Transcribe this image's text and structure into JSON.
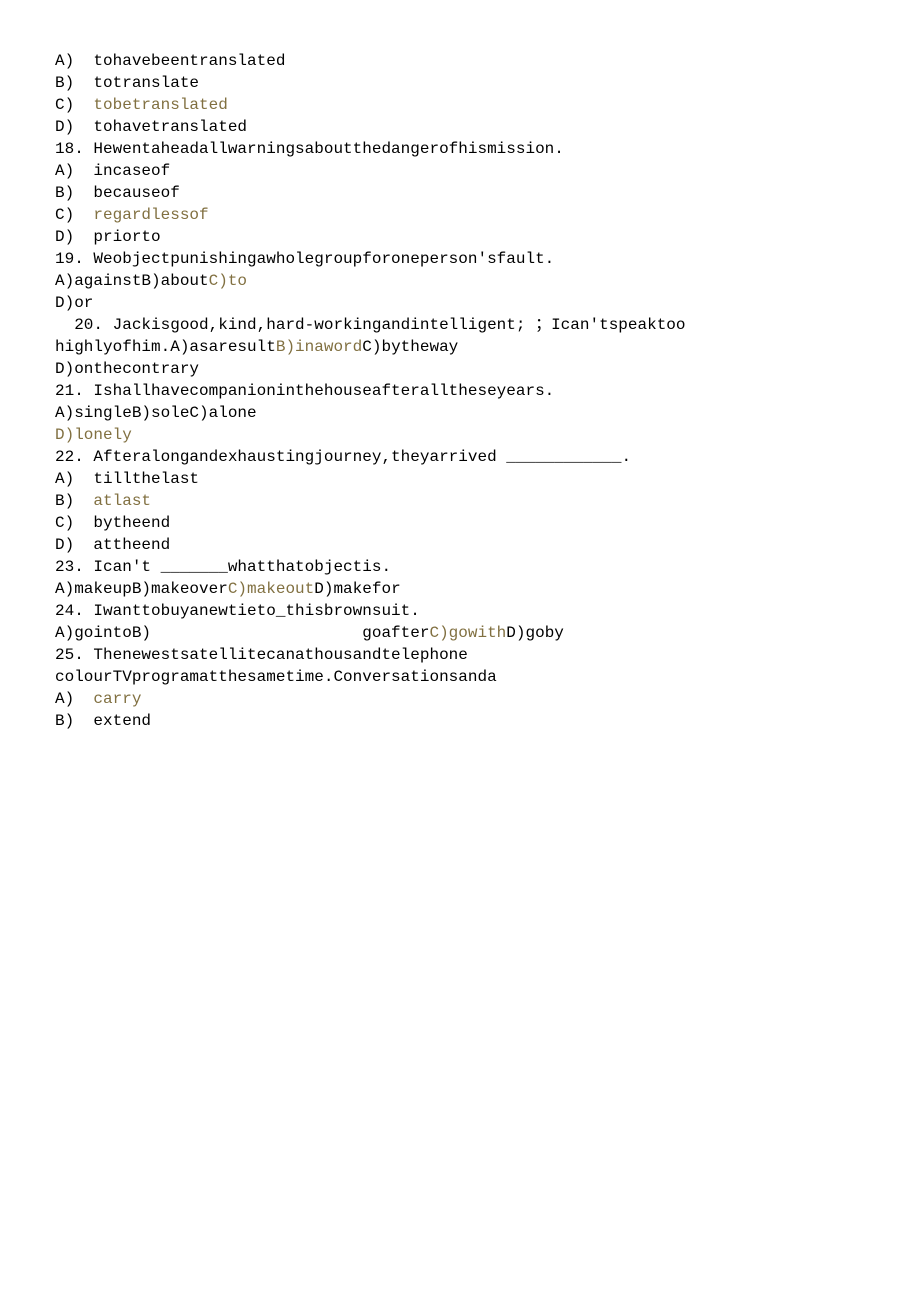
{
  "lines": [
    {
      "segs": [
        {
          "t": "A)  tohavebeentranslated"
        }
      ]
    },
    {
      "segs": [
        {
          "t": "B)  totranslate"
        }
      ]
    },
    {
      "segs": [
        {
          "t": "C)  "
        },
        {
          "t": "tobetranslated",
          "hl": true
        }
      ]
    },
    {
      "segs": [
        {
          "t": "D)  tohavetranslated"
        }
      ]
    },
    {
      "segs": [
        {
          "t": "18. Hewentaheadallwarningsaboutthedangerofhismission."
        }
      ]
    },
    {
      "segs": [
        {
          "t": "A)  incaseof"
        }
      ]
    },
    {
      "segs": [
        {
          "t": "B)  becauseof"
        }
      ]
    },
    {
      "segs": [
        {
          "t": "C)  "
        },
        {
          "t": "regardlessof",
          "hl": true
        }
      ]
    },
    {
      "segs": [
        {
          "t": "D)  priorto"
        }
      ]
    },
    {
      "segs": [
        {
          "t": "19. Weobjectpunishingawholegroupforoneperson'sfault."
        }
      ]
    },
    {
      "segs": [
        {
          "t": "A)againstB)about"
        },
        {
          "t": "C)to",
          "hl": true
        }
      ]
    },
    {
      "segs": [
        {
          "t": "D)or"
        }
      ]
    },
    {
      "segs": [
        {
          "t": "  20. Jackisgood,kind,hard-workingandintelligent; ；Ican'tspeaktoo"
        }
      ]
    },
    {
      "segs": [
        {
          "t": "highlyofhim.A)asaresult"
        },
        {
          "t": "B)inaword",
          "hl": true
        },
        {
          "t": "C)bytheway"
        }
      ]
    },
    {
      "segs": [
        {
          "t": "D)onthecontrary"
        }
      ]
    },
    {
      "segs": [
        {
          "t": "21. Ishallhavecompanioninthehouseafteralltheseyears."
        }
      ]
    },
    {
      "segs": [
        {
          "t": "A)singleB)soleC)alone"
        }
      ]
    },
    {
      "segs": [
        {
          "t": "D)lonely",
          "hl": true
        }
      ]
    },
    {
      "segs": [
        {
          "t": "22. Afteralongandexhaustingjourney,theyarrived ____________."
        }
      ]
    },
    {
      "segs": [
        {
          "t": "A)  tillthelast"
        }
      ]
    },
    {
      "segs": [
        {
          "t": "B)  "
        },
        {
          "t": "atlast",
          "hl": true
        }
      ]
    },
    {
      "segs": [
        {
          "t": "C)  bytheend"
        }
      ]
    },
    {
      "segs": [
        {
          "t": "D)  attheend"
        }
      ]
    },
    {
      "segs": [
        {
          "t": "23. Ican't _______whatthatobjectis."
        }
      ]
    },
    {
      "segs": [
        {
          "t": "A)makeupB)makeover"
        },
        {
          "t": "C)makeout",
          "hl": true
        },
        {
          "t": "D)makefor"
        }
      ]
    },
    {
      "segs": [
        {
          "t": "24. Iwanttobuyanewtieto_thisbrownsuit."
        }
      ]
    },
    {
      "segs": [
        {
          "t": "A)gointoB)                      goafter"
        },
        {
          "t": "C)gowith",
          "hl": true
        },
        {
          "t": "D)goby"
        }
      ]
    },
    {
      "segs": [
        {
          "t": "25. Thenewestsatellitecanathousandtelephone"
        }
      ]
    },
    {
      "segs": [
        {
          "t": "colourTVprogramatthesametime.Conversationsanda"
        }
      ]
    },
    {
      "segs": [
        {
          "t": "A)  "
        },
        {
          "t": "carry",
          "hl": true
        }
      ]
    },
    {
      "segs": [
        {
          "t": "B)  extend"
        }
      ]
    }
  ]
}
